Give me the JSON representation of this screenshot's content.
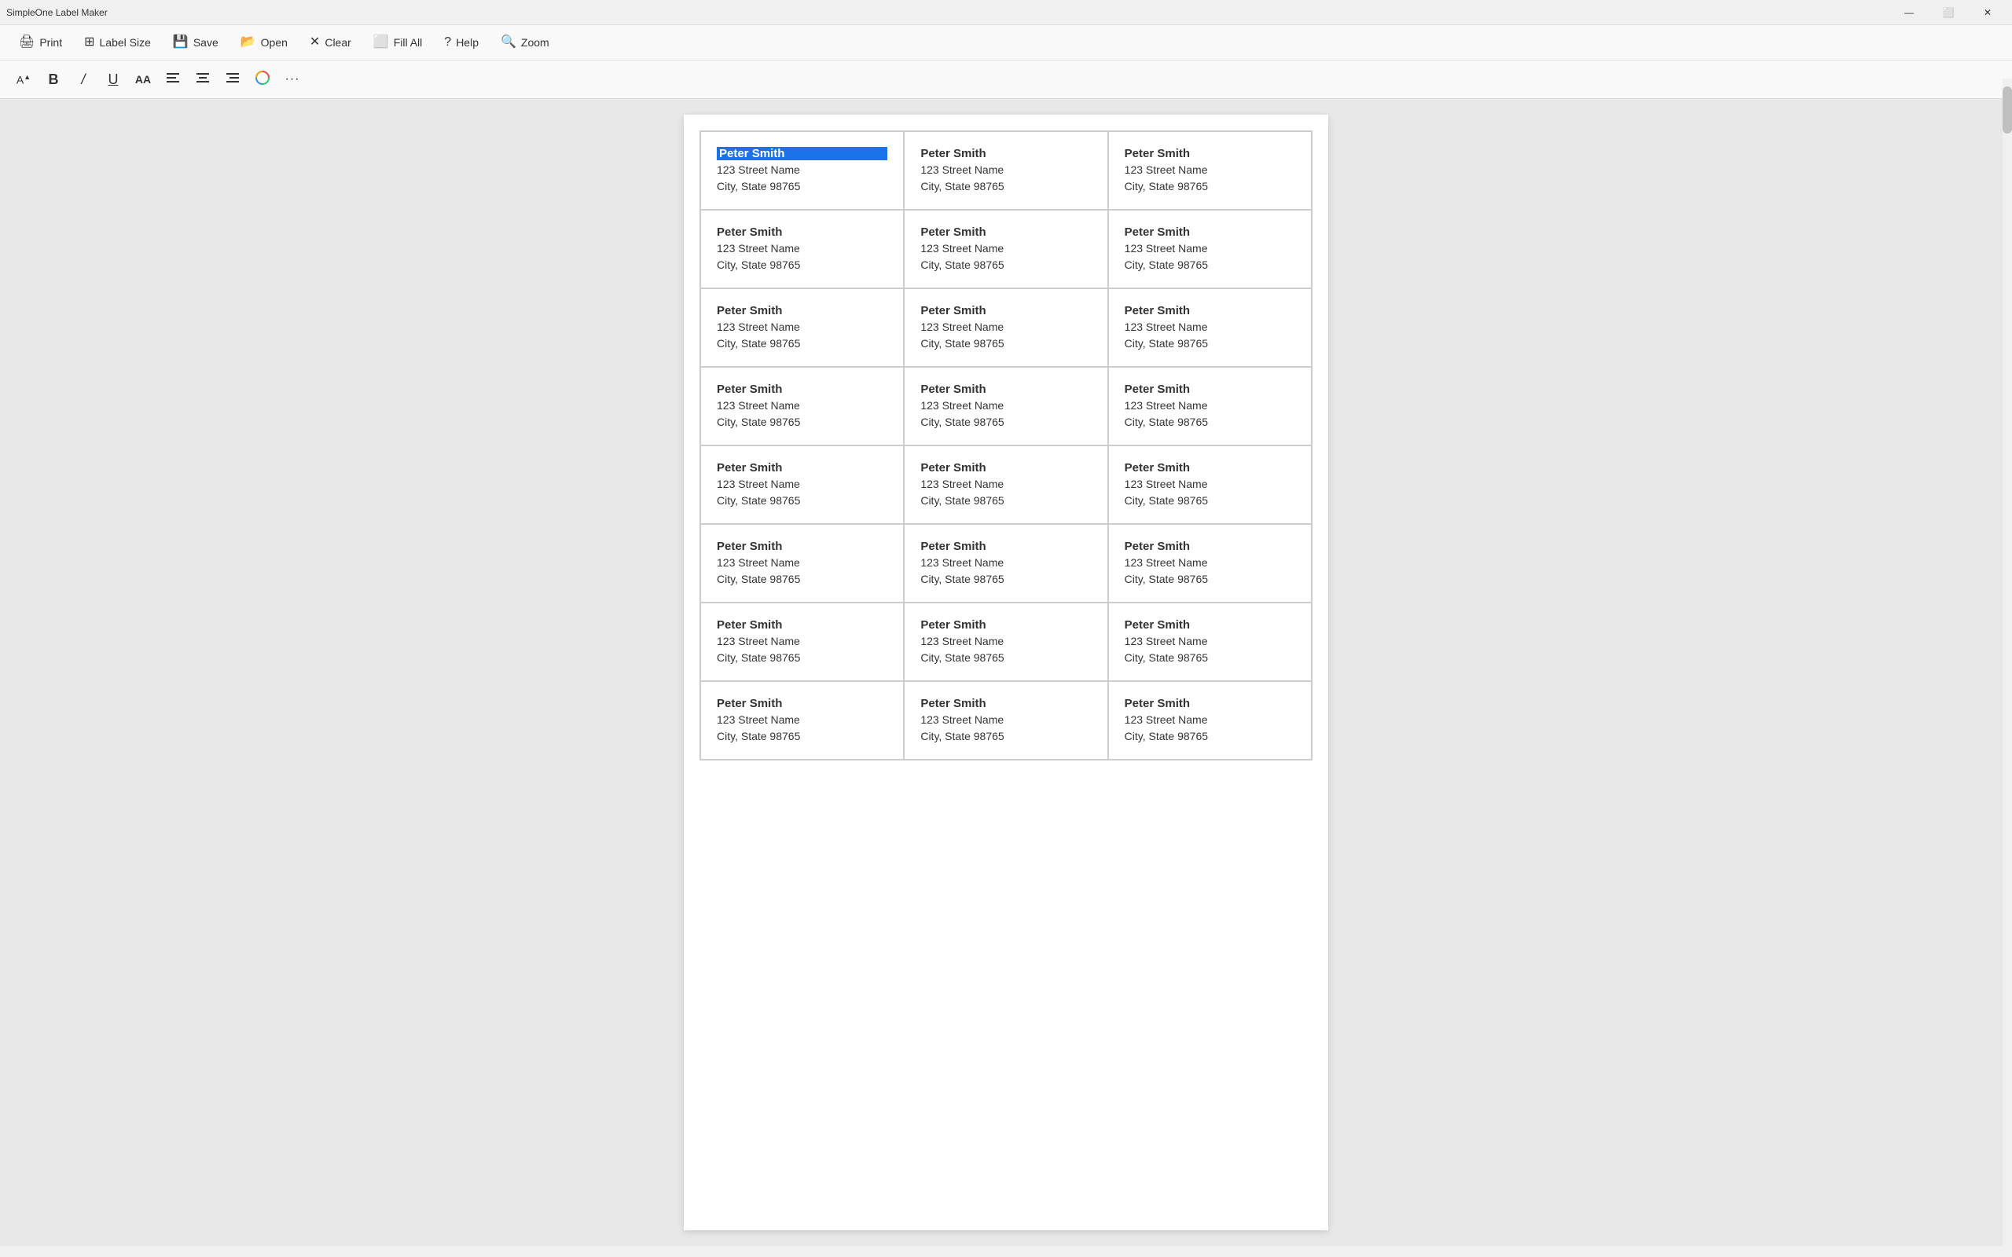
{
  "app": {
    "title": "SimpleOne Label Maker"
  },
  "titlebar": {
    "minimize_label": "—",
    "maximize_label": "⬜",
    "close_label": "✕"
  },
  "toolbar": {
    "print_label": "Print",
    "label_size_label": "Label Size",
    "save_label": "Save",
    "open_label": "Open",
    "clear_label": "Clear",
    "fill_all_label": "Fill All",
    "help_label": "Help",
    "zoom_label": "Zoom"
  },
  "format_toolbar": {
    "font_size_icon": "A",
    "bold_label": "B",
    "italic_label": "/",
    "underline_label": "U",
    "font_label": "AA",
    "align_left_label": "≡",
    "align_center_label": "≡",
    "align_right_label": "≡",
    "color_label": "🎨",
    "more_label": "···"
  },
  "labels": {
    "name": "Peter Smith",
    "street": "123 Street Name",
    "city_state": "City, State 98765",
    "rows": 8,
    "cols": 3,
    "first_selected": true,
    "selected_color": "#1a73e8"
  }
}
